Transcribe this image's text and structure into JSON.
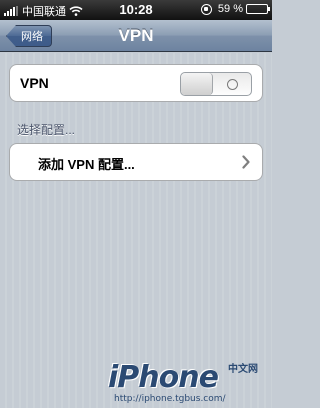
{
  "status_bar": {
    "carrier": "中国联通",
    "time": "10:28",
    "battery_text": "59 %",
    "battery_level": 0.59
  },
  "nav_bar": {
    "back_label": "网络",
    "title": "VPN"
  },
  "vpn_row": {
    "label": "VPN",
    "toggle_state": "off"
  },
  "section_header": "选择配置...",
  "add_row": {
    "label": "添加 VPN 配置..."
  },
  "watermark": {
    "logo": "iPhone",
    "cn": "中文网",
    "url": "http://iphone.tgbus.com/"
  },
  "colors": {
    "nav_bar": "#6d83a0",
    "background": "#c5ccd4",
    "section_header": "#4c566c"
  }
}
